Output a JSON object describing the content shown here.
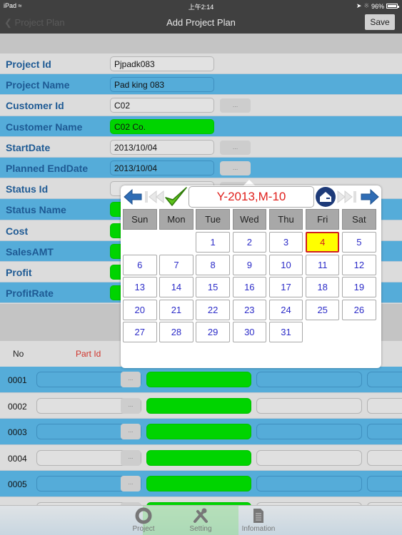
{
  "statusbar": {
    "device": "iPad",
    "time": "上午2:14",
    "battery": "96%"
  },
  "navbar": {
    "back_label": "Project Plan",
    "title": "Add Project Plan",
    "save_label": "Save"
  },
  "form": {
    "fields": [
      {
        "label": "Project Id",
        "value": "Pjpadk083",
        "style": "light",
        "green": false,
        "picker": false
      },
      {
        "label": "Project Name",
        "value": "Pad king 083",
        "style": "blue",
        "green": false,
        "picker": false
      },
      {
        "label": "Customer Id",
        "value": "C02",
        "style": "light",
        "green": false,
        "picker": true
      },
      {
        "label": "Customer Name",
        "value": "C02 Co.",
        "style": "blue",
        "green": true,
        "picker": false
      },
      {
        "label": "StartDate",
        "value": "2013/10/04",
        "style": "light",
        "green": false,
        "picker": true
      },
      {
        "label": "Planned EndDate",
        "value": "2013/10/04",
        "style": "blue",
        "green": false,
        "picker": true
      },
      {
        "label": "Status Id",
        "value": "",
        "style": "light",
        "green": false,
        "picker": true
      },
      {
        "label": "Status Name",
        "value": "",
        "style": "blue",
        "green": true,
        "picker": false
      },
      {
        "label": "Cost",
        "value": "",
        "style": "light",
        "green": true,
        "picker": false
      },
      {
        "label": "SalesAMT",
        "value": "",
        "style": "blue",
        "green": true,
        "picker": false
      },
      {
        "label": "Profit",
        "value": "",
        "style": "light",
        "green": true,
        "picker": false
      },
      {
        "label": "ProfitRate",
        "value": "",
        "style": "blue",
        "green": true,
        "picker": false
      }
    ],
    "picker_label": "..."
  },
  "table": {
    "headers": {
      "no": "No",
      "part_id": "Part Id"
    },
    "rows": [
      {
        "no": "0001",
        "style": "blue"
      },
      {
        "no": "0002",
        "style": "light"
      },
      {
        "no": "0003",
        "style": "blue"
      },
      {
        "no": "0004",
        "style": "light"
      },
      {
        "no": "0005",
        "style": "blue"
      },
      {
        "no": "",
        "style": "light"
      }
    ],
    "picker_label": "..."
  },
  "calendar": {
    "title": "Y-2013,M-10",
    "year": 2013,
    "month": 10,
    "selected_day": 4,
    "weekdays": [
      "Sun",
      "Mon",
      "Tue",
      "Wed",
      "Thu",
      "Fri",
      "Sat"
    ],
    "first_weekday_index": 2,
    "days_in_month": 31,
    "colors": {
      "title": "#e0201c",
      "day_text": "#2c2cc8",
      "selected_bg": "#ffff00",
      "selected_border": "#d02020"
    }
  },
  "tabbar": {
    "tabs": [
      {
        "label": "Project",
        "icon": "gear-icon",
        "active": true
      },
      {
        "label": "Setting",
        "icon": "tools-icon",
        "active": false
      },
      {
        "label": "Infomation",
        "icon": "document-icon",
        "active": false
      }
    ]
  },
  "colors": {
    "row_blue": "#55acd9",
    "row_light": "#dcdcdc",
    "label_text": "#1e5a94",
    "green_field": "#00d400",
    "navbar": "#404040"
  }
}
